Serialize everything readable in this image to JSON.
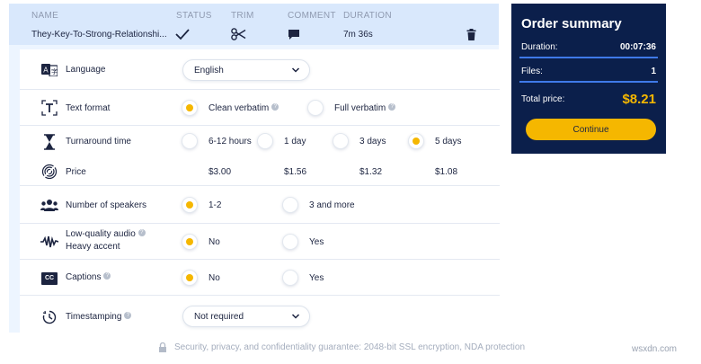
{
  "file_table": {
    "headers": {
      "name": "NAME",
      "status": "STATUS",
      "trim": "TRIM",
      "comment": "COMMENT",
      "duration": "DURATION"
    },
    "file": {
      "name": "They-Key-To-Strong-Relationshi...",
      "status_icon": "checkmark-icon",
      "trim_icon": "scissors-icon",
      "comment_icon": "comment-icon",
      "duration": "7m 36s",
      "delete_icon": "trash-icon"
    }
  },
  "options": {
    "language": {
      "label": "Language",
      "value": "English"
    },
    "text_format": {
      "label": "Text format",
      "options": [
        {
          "label": "Clean verbatim",
          "selected": true,
          "help": true
        },
        {
          "label": "Full verbatim",
          "selected": false,
          "help": true
        }
      ]
    },
    "turnaround": {
      "label": "Turnaround time",
      "options": [
        {
          "label": "6-12 hours",
          "selected": false
        },
        {
          "label": "1 day",
          "selected": false
        },
        {
          "label": "3 days",
          "selected": false
        },
        {
          "label": "5 days",
          "selected": true
        }
      ]
    },
    "price": {
      "label": "Price",
      "values": [
        "$3.00",
        "$1.56",
        "$1.32",
        "$1.08"
      ]
    },
    "speakers": {
      "label": "Number of speakers",
      "options": [
        {
          "label": "1-2",
          "selected": true
        },
        {
          "label": "3 and more",
          "selected": false
        }
      ]
    },
    "audio_quality": {
      "label_line1": "Low-quality audio",
      "label_line2": "Heavy accent",
      "options": [
        {
          "label": "No",
          "selected": true
        },
        {
          "label": "Yes",
          "selected": false
        }
      ]
    },
    "captions": {
      "label": "Captions",
      "icon_text": "CC",
      "options": [
        {
          "label": "No",
          "selected": true
        },
        {
          "label": "Yes",
          "selected": false
        }
      ]
    },
    "timestamping": {
      "label": "Timestamping",
      "value": "Not required"
    }
  },
  "summary": {
    "title": "Order summary",
    "duration_label": "Duration:",
    "duration_value": "00:07:36",
    "files_label": "Files:",
    "files_value": "1",
    "total_label": "Total price:",
    "total_value": "$8.21",
    "continue_label": "Continue"
  },
  "footer": {
    "text": "Security, privacy, and confidentiality guarantee: 2048-bit SSL encryption, NDA protection"
  },
  "watermark": "wsxdn.com",
  "colors": {
    "accent": "#f5b700",
    "summary_bg": "#0b1f4b",
    "panel_bg": "#edf5ff",
    "header_bg": "#d9e8fc",
    "divider": "#3f79e8"
  }
}
